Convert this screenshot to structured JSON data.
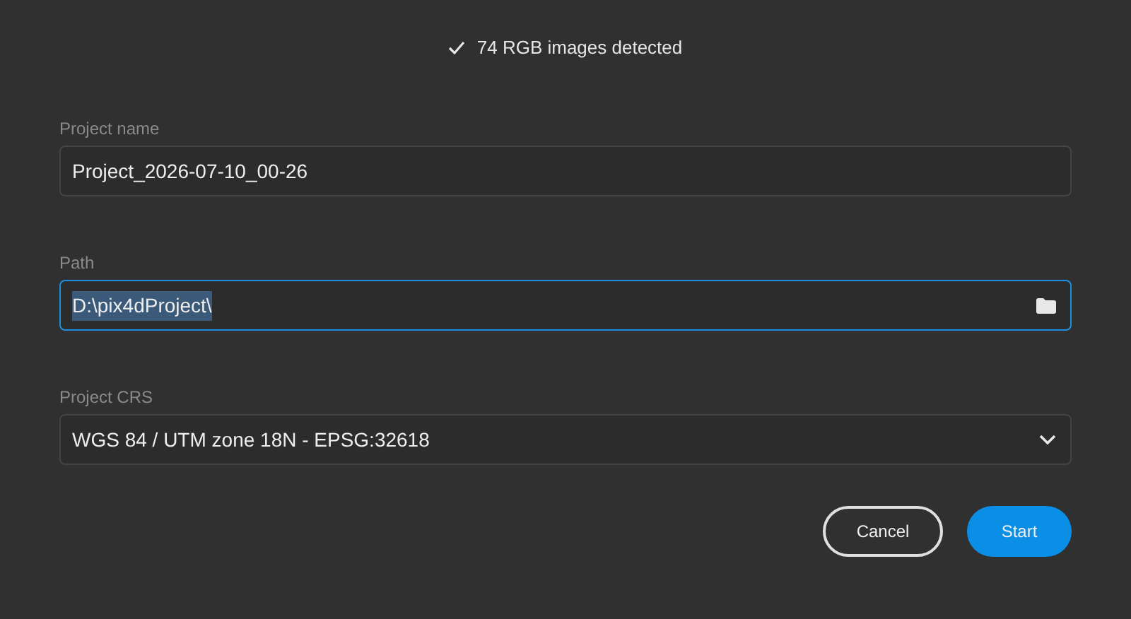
{
  "status": {
    "text": "74 RGB images detected"
  },
  "fields": [
    {
      "kind": "text",
      "label": "Project name",
      "value": "Project_2026-07-10_00-26",
      "focused": false,
      "text_selected": false
    },
    {
      "kind": "path",
      "label": "Path",
      "value": "D:\\pix4dProject\\",
      "focused": true,
      "text_selected": true
    },
    {
      "kind": "select",
      "label": "Project CRS",
      "value": "WGS 84 / UTM zone 18N - EPSG:32618",
      "focused": false,
      "text_selected": false
    }
  ],
  "buttons": [
    {
      "kind": "secondary",
      "label": "Cancel"
    },
    {
      "kind": "primary",
      "label": "Start"
    }
  ]
}
